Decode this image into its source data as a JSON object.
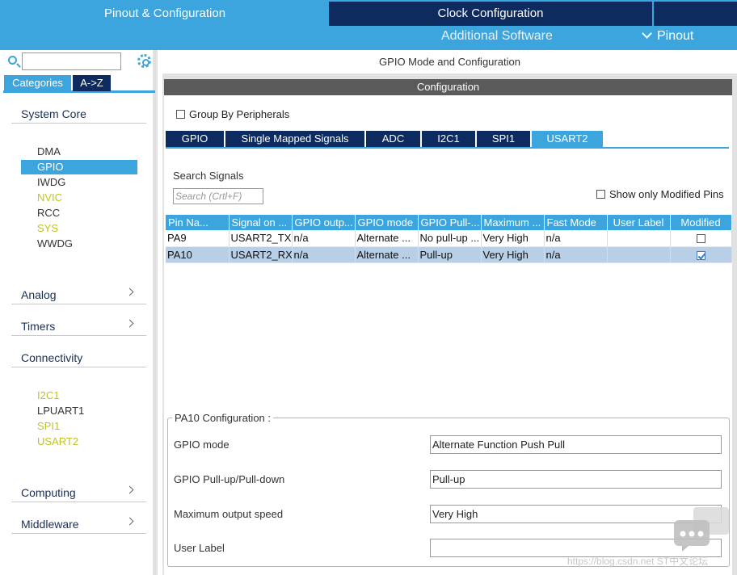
{
  "top": {
    "tab_pinout": "Pinout & Configuration",
    "tab_clock": "Clock Configuration",
    "additional_software": "Additional Software",
    "pinout_menu": "Pinout"
  },
  "left": {
    "search_placeholder": "",
    "tab_categories": "Categories",
    "tab_atoz": "A->Z",
    "system_core": "System Core",
    "system_core_items": [
      "DMA",
      "GPIO",
      "IWDG",
      "NVIC",
      "RCC",
      "SYS",
      "WWDG"
    ],
    "analog": "Analog",
    "timers": "Timers",
    "connectivity": "Connectivity",
    "connectivity_items": [
      "I2C1",
      "LPUART1",
      "SPI1",
      "USART2"
    ],
    "computing": "Computing",
    "middleware": "Middleware"
  },
  "main": {
    "title": "GPIO Mode and Configuration",
    "config_header": "Configuration",
    "group_by": "Group By Peripherals",
    "tabs": [
      "GPIO",
      "Single Mapped Signals",
      "ADC",
      "I2C1",
      "SPI1",
      "USART2"
    ],
    "search_signals": "Search Signals",
    "search_placeholder": "Search (Crtl+F)",
    "show_modified": "Show only Modified Pins",
    "table": {
      "headers": [
        "Pin Na...",
        "Signal on ...",
        "GPIO outp...",
        "GPIO mode",
        "GPIO Pull-...",
        "Maximum ...",
        "Fast Mode",
        "User Label",
        "Modified"
      ],
      "rows": [
        [
          "PA9",
          "USART2_TX",
          "n/a",
          "Alternate ...",
          "No pull-up ...",
          "Very High",
          "n/a",
          "",
          ""
        ],
        [
          "PA10",
          "USART2_RX",
          "n/a",
          "Alternate ...",
          "Pull-up",
          "Very High",
          "n/a",
          "",
          ""
        ]
      ],
      "modified": [
        false,
        true
      ],
      "selected_row": 1
    },
    "pin_config": {
      "legend": "PA10 Configuration :",
      "gpio_mode_label": "GPIO mode",
      "gpio_mode_value": "Alternate Function Push Pull",
      "pull_label": "GPIO Pull-up/Pull-down",
      "pull_value": "Pull-up",
      "speed_label": "Maximum output speed",
      "speed_value": "Very High",
      "user_label": "User Label",
      "user_value": ""
    }
  },
  "watermark": "https://blog.csdn.net  ST中文论坛",
  "colors": {
    "accent": "#3ca5de",
    "dark_tab": "#0d2b5e",
    "peripheral_yellow": "#bfc420",
    "selection": "#b9cfe6"
  }
}
